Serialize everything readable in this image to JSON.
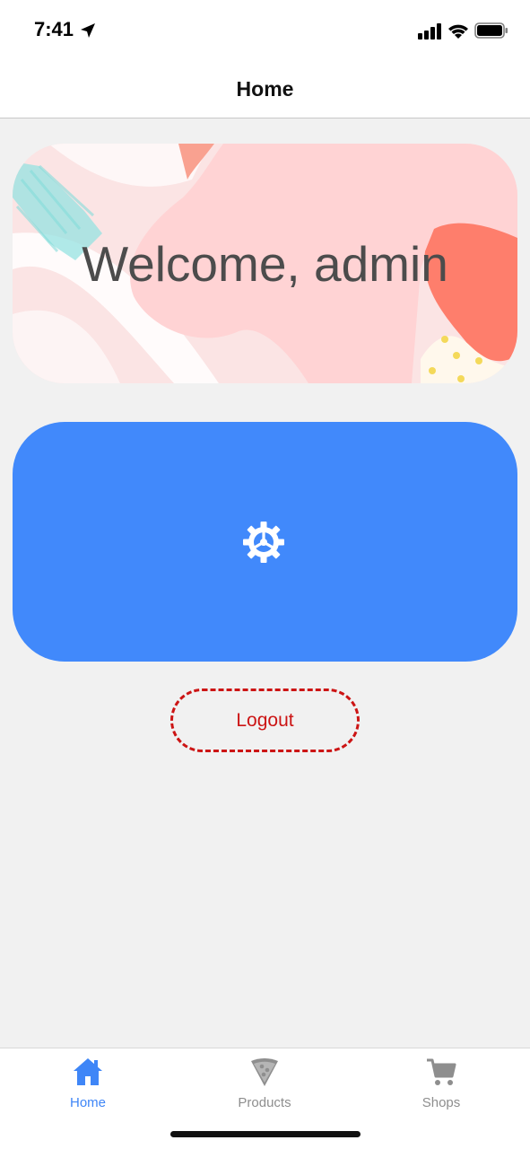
{
  "status_bar": {
    "time": "7:41"
  },
  "header": {
    "title": "Home"
  },
  "welcome": {
    "text": "Welcome, admin"
  },
  "settings_card": {
    "icon": "gear-icon",
    "color": "#4189fb"
  },
  "logout": {
    "label": "Logout",
    "color": "#cc1414"
  },
  "tab_bar": {
    "active_color": "#3f86f7",
    "inactive_color": "#8e8e8e",
    "tabs": [
      {
        "label": "Home",
        "icon": "home-icon",
        "active": true
      },
      {
        "label": "Products",
        "icon": "pizza-icon",
        "active": false
      },
      {
        "label": "Shops",
        "icon": "cart-icon",
        "active": false
      }
    ]
  }
}
